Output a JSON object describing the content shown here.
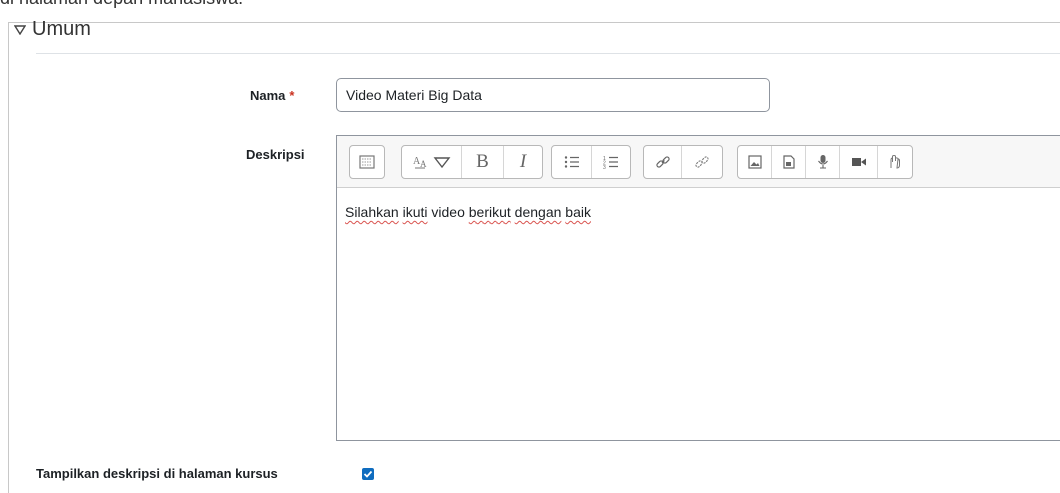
{
  "top_cut_text": "di halaman depan mahasiswa.",
  "section": {
    "title": "Umum"
  },
  "form": {
    "name_label": "Nama",
    "required_mark": "*",
    "name_value": "Video Materi Big Data",
    "description_label": "Deskripsi",
    "description_parts": [
      "Silahkan",
      "ikuti",
      "video",
      "berikut",
      "dengan",
      "baik"
    ],
    "show_description_label": "Tampilkan deskripsi di halaman kursus",
    "show_description_checked": true
  },
  "toolbar": {
    "icons": [
      "toolbar-toggle-icon",
      "font-style-icon",
      "bold-icon",
      "italic-icon",
      "unordered-list-icon",
      "ordered-list-icon",
      "link-icon",
      "unlink-icon",
      "image-icon",
      "media-icon",
      "record-audio-icon",
      "record-video-icon",
      "manage-files-icon"
    ],
    "bold_glyph": "B",
    "italic_glyph": "I"
  }
}
